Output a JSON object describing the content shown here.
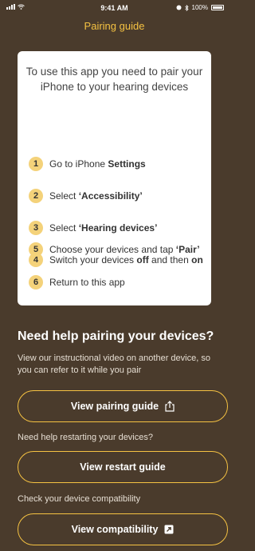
{
  "status": {
    "time": "9:41 AM",
    "battery": "100%"
  },
  "nav": {
    "title": "Pairing guide"
  },
  "card": {
    "intro": "To use this app you need to pair your iPhone to your hearing devices",
    "steps": [
      {
        "num": "1",
        "pre": "Go to iPhone ",
        "bold": "Settings",
        "post": ""
      },
      {
        "num": "2",
        "pre": "Select ",
        "bold": "‘Accessibility’",
        "post": ""
      },
      {
        "num": "3",
        "pre": "Select ",
        "bold": "‘Hearing devices’",
        "post": ""
      },
      {
        "num": "4",
        "pre": "Switch your devices ",
        "bold": "off",
        "mid": " and then ",
        "bold2": "on"
      },
      {
        "num": "5",
        "pre": "Choose your devices and tap ",
        "bold": "‘Pair’",
        "post": ""
      },
      {
        "num": "6",
        "pre": "Return to this app",
        "bold": "",
        "post": ""
      }
    ]
  },
  "help": {
    "heading": "Need help pairing your devices?",
    "description": "View our instructional video on another device, so you can refer to it while you pair",
    "pairing_button": "View pairing guide",
    "restart_label": "Need help restarting your devices?",
    "restart_button": "View restart guide",
    "compat_label": "Check your device compatibility",
    "compat_button": "View compatibility"
  },
  "colors": {
    "background": "#4a3b2c",
    "accent": "#f5c242",
    "step_badge": "#f4d27a"
  },
  "icons": {
    "share": "share-icon",
    "external": "external-link-icon"
  }
}
